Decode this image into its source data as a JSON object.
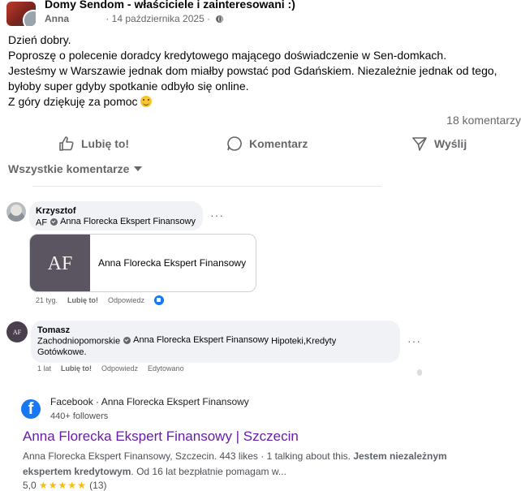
{
  "post": {
    "group_name": "Domy Sendom - właściciele i zainteresowani :)",
    "author": "Anna",
    "date": "· 14 października 2025 ·",
    "lines": [
      "Dzień dobry.",
      "Poproszę o polecenie doradcy kredytowego mającego doświadczenie w Sen-domkach.",
      "Jesteśmy w Warszawie jednak dom miałby powstać pod Gdańskiem. Niezależnie jednak od tego,",
      "byłoby super gdyby spotkanie odbyło się online.",
      "Z góry dziękuję za pomoc"
    ],
    "comments_count": "18 komentarzy"
  },
  "actions": {
    "like": "Lubię to!",
    "comment": "Komentarz",
    "share": "Wyślij"
  },
  "sort_label": "Wszystkie komentarze",
  "comments": [
    {
      "name": "Krzysztof",
      "prefix": "AF",
      "mention": "Anna Florecka Ekspert Finansowy",
      "card_title": "Anna Florecka Ekspert Finansowy",
      "card_logo": "AF",
      "time": "21 tyg.",
      "like": "Lubię to!",
      "reply": "Odpowiedz"
    },
    {
      "name": "Tomasz",
      "avatar_text": "AF",
      "prefix": "Zachodniopomorskie",
      "mention": "Anna Florecka Ekspert Finansowy",
      "rest": "Hipoteki,Kredyty",
      "line2": "Gotówkowe.",
      "time": "1 lat",
      "like": "Lubię to!",
      "reply": "Odpowiedz",
      "edited": "Edytowano"
    }
  ],
  "search_result": {
    "site": "Facebook · Anna Florecka Ekspert Finansowy",
    "followers": "440+ followers",
    "title": "Anna Florecka Ekspert Finansowy | Szczecin",
    "snippet_plain": "Anna Florecka Ekspert Finansowy, Szczecin. 443 likes · 1 talking about this. ",
    "snippet_bold1": "Jestem niezależnym",
    "snippet_bold2": "ekspertem kredytowym",
    "snippet_end": ". Od 16 lat bezpłatnie pomagam w...",
    "rating_value": "5,0",
    "stars": "★★★★★",
    "rating_count": "(13)"
  },
  "colors": {
    "accent": "#1877f2",
    "link_visited": "#681da8",
    "muted": "#65676b"
  },
  "icons": [
    "globe-icon",
    "thumbs-up-icon",
    "comment-icon",
    "share-icon",
    "facebook-icon",
    "check-badge-icon",
    "smile-emoji-icon"
  ]
}
